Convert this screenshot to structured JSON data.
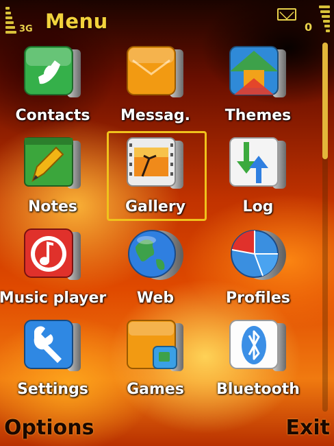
{
  "status": {
    "network": "3G",
    "title": "Menu",
    "message_count": "0"
  },
  "menu": {
    "items": [
      {
        "label": "Contacts",
        "icon": "phone-icon",
        "color": "#35b04a"
      },
      {
        "label": "Messag.",
        "icon": "envelope-icon",
        "color": "#f29a12"
      },
      {
        "label": "Themes",
        "icon": "themes-arrow-icon",
        "color": "#3da14a"
      },
      {
        "label": "Notes",
        "icon": "notes-pen-icon",
        "color": "#3ba63c"
      },
      {
        "label": "Gallery",
        "icon": "gallery-film-icon",
        "color": "#e9e9e9"
      },
      {
        "label": "Log",
        "icon": "log-arrows-icon",
        "color": "#f2f2f2"
      },
      {
        "label": "Music player",
        "icon": "music-note-icon",
        "color": "#e0312b"
      },
      {
        "label": "Web",
        "icon": "globe-icon",
        "color": "#2f7fe0"
      },
      {
        "label": "Profiles",
        "icon": "profiles-pie-icon",
        "color": "#3a8fe0"
      },
      {
        "label": "Settings",
        "icon": "wrench-icon",
        "color": "#2f88e3"
      },
      {
        "label": "Games",
        "icon": "games-folder-icon",
        "color": "#f29a12"
      },
      {
        "label": "Bluetooth",
        "icon": "bluetooth-icon",
        "color": "#3b8fe6"
      }
    ],
    "selected_index": 4
  },
  "softkeys": {
    "left": "Options",
    "right": "Exit"
  }
}
